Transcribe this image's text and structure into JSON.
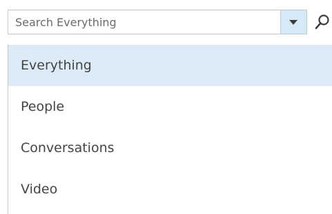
{
  "search": {
    "placeholder": "Search Everything",
    "value": "",
    "dropdown_icon": "caret-down-icon",
    "search_icon": "magnifier-icon"
  },
  "scope_menu": {
    "items": [
      {
        "label": "Everything",
        "selected": true
      },
      {
        "label": "People",
        "selected": false
      },
      {
        "label": "Conversations",
        "selected": false
      },
      {
        "label": "Video",
        "selected": false
      }
    ]
  },
  "colors": {
    "selected_background": "#dcebf7",
    "border": "#c6c6c6",
    "text": "#444444"
  }
}
